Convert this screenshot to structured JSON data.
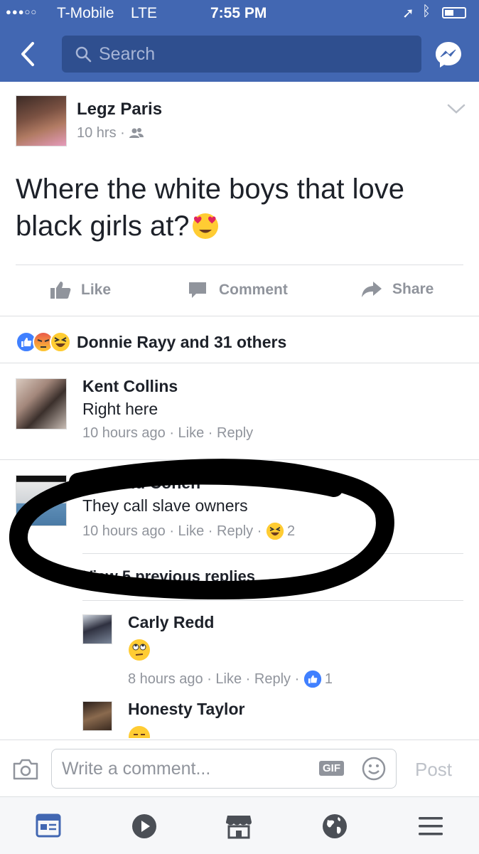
{
  "status": {
    "carrier": "T-Mobile",
    "network": "LTE",
    "time": "7:55 PM"
  },
  "nav": {
    "search_placeholder": "Search"
  },
  "post": {
    "author": "Legz Paris",
    "time": "10 hrs",
    "text_line1": "Where the white boys that love",
    "text_line2": "black girls at?",
    "actions": {
      "like": "Like",
      "comment": "Comment",
      "share": "Share"
    },
    "reactions_summary": "Donnie Rayy and 31 others"
  },
  "comments": [
    {
      "name": "Kent Collins",
      "text": "Right here",
      "time": "10 hours ago",
      "like": "Like",
      "reply": "Reply"
    },
    {
      "name": "esmond Cohen",
      "text": "They call slave owners",
      "time": "10 hours ago",
      "like": "Like",
      "reply": "Reply",
      "reaction_count": "2",
      "view_replies": "View 5 previous replies"
    }
  ],
  "replies": [
    {
      "name": "Carly Redd",
      "time": "8 hours ago",
      "like": "Like",
      "reply": "Reply",
      "reaction_count": "1"
    },
    {
      "name": "Honesty Taylor"
    }
  ],
  "composer": {
    "placeholder": "Write a comment...",
    "gif_label": "GIF",
    "post_label": "Post"
  },
  "colors": {
    "brand": "#4267b2",
    "muted": "#90949c",
    "like_blue": "#4080ff"
  }
}
